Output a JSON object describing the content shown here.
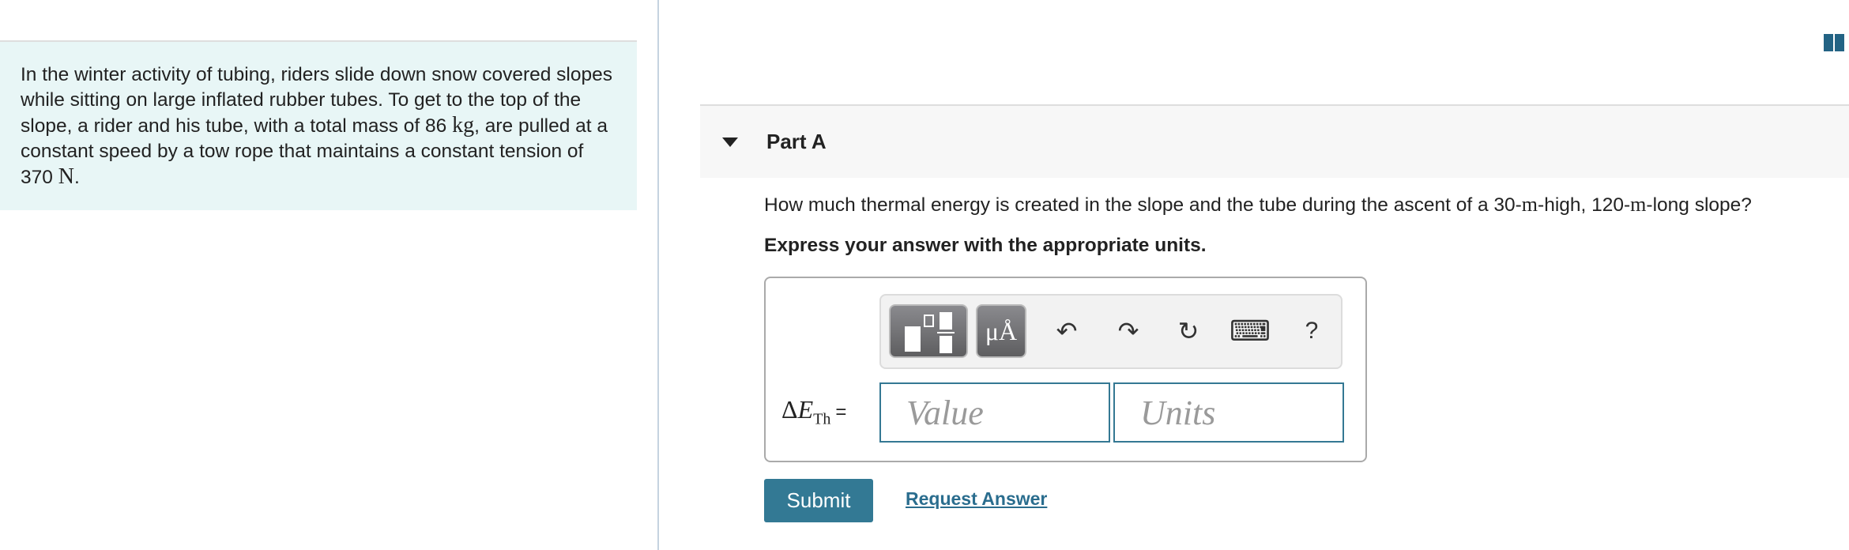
{
  "intro": {
    "text_1": "In the winter activity of tubing, riders slide down snow covered slopes while sitting on large inflated rubber tubes. To get to the top of the slope, a rider and his tube, with a total mass of 86",
    "unit_1": "kg",
    "text_2": ", are pulled at a constant speed by a tow rope that maintains a constant tension of 370",
    "unit_2": "N",
    "text_3": "."
  },
  "part": {
    "title": "Part A",
    "question_1": "How much thermal energy is created in the slope and the tube during the ascent of a 30-",
    "question_m1": "m",
    "question_2": "-high, 120-",
    "question_m2": "m",
    "question_3": "-long slope?",
    "instruction": "Express your answer with the appropriate units."
  },
  "toolbar": {
    "symbols_label": "μÅ",
    "undo_icon": "↶",
    "redo_icon": "↷",
    "reset_icon": "↻",
    "keyboard_icon": "⌨",
    "help_label": "?"
  },
  "answer": {
    "delta": "Δ",
    "var": "E",
    "subscript": "Th",
    "equals": "=",
    "value_placeholder": "Value",
    "units_placeholder": "Units"
  },
  "actions": {
    "submit_label": "Submit",
    "request_answer_label": "Request Answer"
  },
  "colors": {
    "accent": "#337994",
    "intro_bg": "#e8f6f6"
  }
}
